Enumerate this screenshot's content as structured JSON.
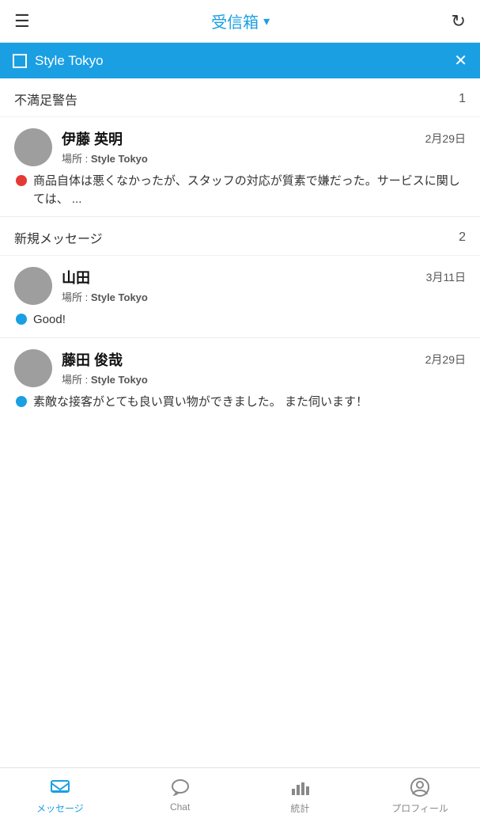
{
  "header": {
    "title": "受信箱",
    "title_caret": "▾",
    "menu_icon": "☰",
    "refresh_icon": "↻"
  },
  "filter": {
    "label": "Style Tokyo",
    "close": "✕"
  },
  "sections": [
    {
      "id": "dissatisfied",
      "title": "不満足警告",
      "count": "1",
      "messages": [
        {
          "name": "伊藤 英明",
          "location_prefix": "場所 : ",
          "location": "Style Tokyo",
          "date": "2月29日",
          "dot_type": "red",
          "preview": "商品自体は悪くなかったが、スタッフの対応が質素で嫌だった。サービスに関しては、 ..."
        }
      ]
    },
    {
      "id": "new-messages",
      "title": "新規メッセージ",
      "count": "2",
      "messages": [
        {
          "name": "山田",
          "location_prefix": "場所 : ",
          "location": "Style Tokyo",
          "date": "3月11日",
          "dot_type": "blue",
          "preview": "Good!"
        },
        {
          "name": "藤田 俊哉",
          "location_prefix": "場所 : ",
          "location": "Style Tokyo",
          "date": "2月29日",
          "dot_type": "blue",
          "preview": "素敵な接客がとても良い買い物ができました。 また伺います！"
        }
      ]
    }
  ],
  "nav": {
    "items": [
      {
        "id": "messages",
        "label": "メッセージ",
        "active": true
      },
      {
        "id": "chat",
        "label": "Chat",
        "active": false
      },
      {
        "id": "stats",
        "label": "統計",
        "active": false
      },
      {
        "id": "profile",
        "label": "プロフィール",
        "active": false
      }
    ]
  }
}
